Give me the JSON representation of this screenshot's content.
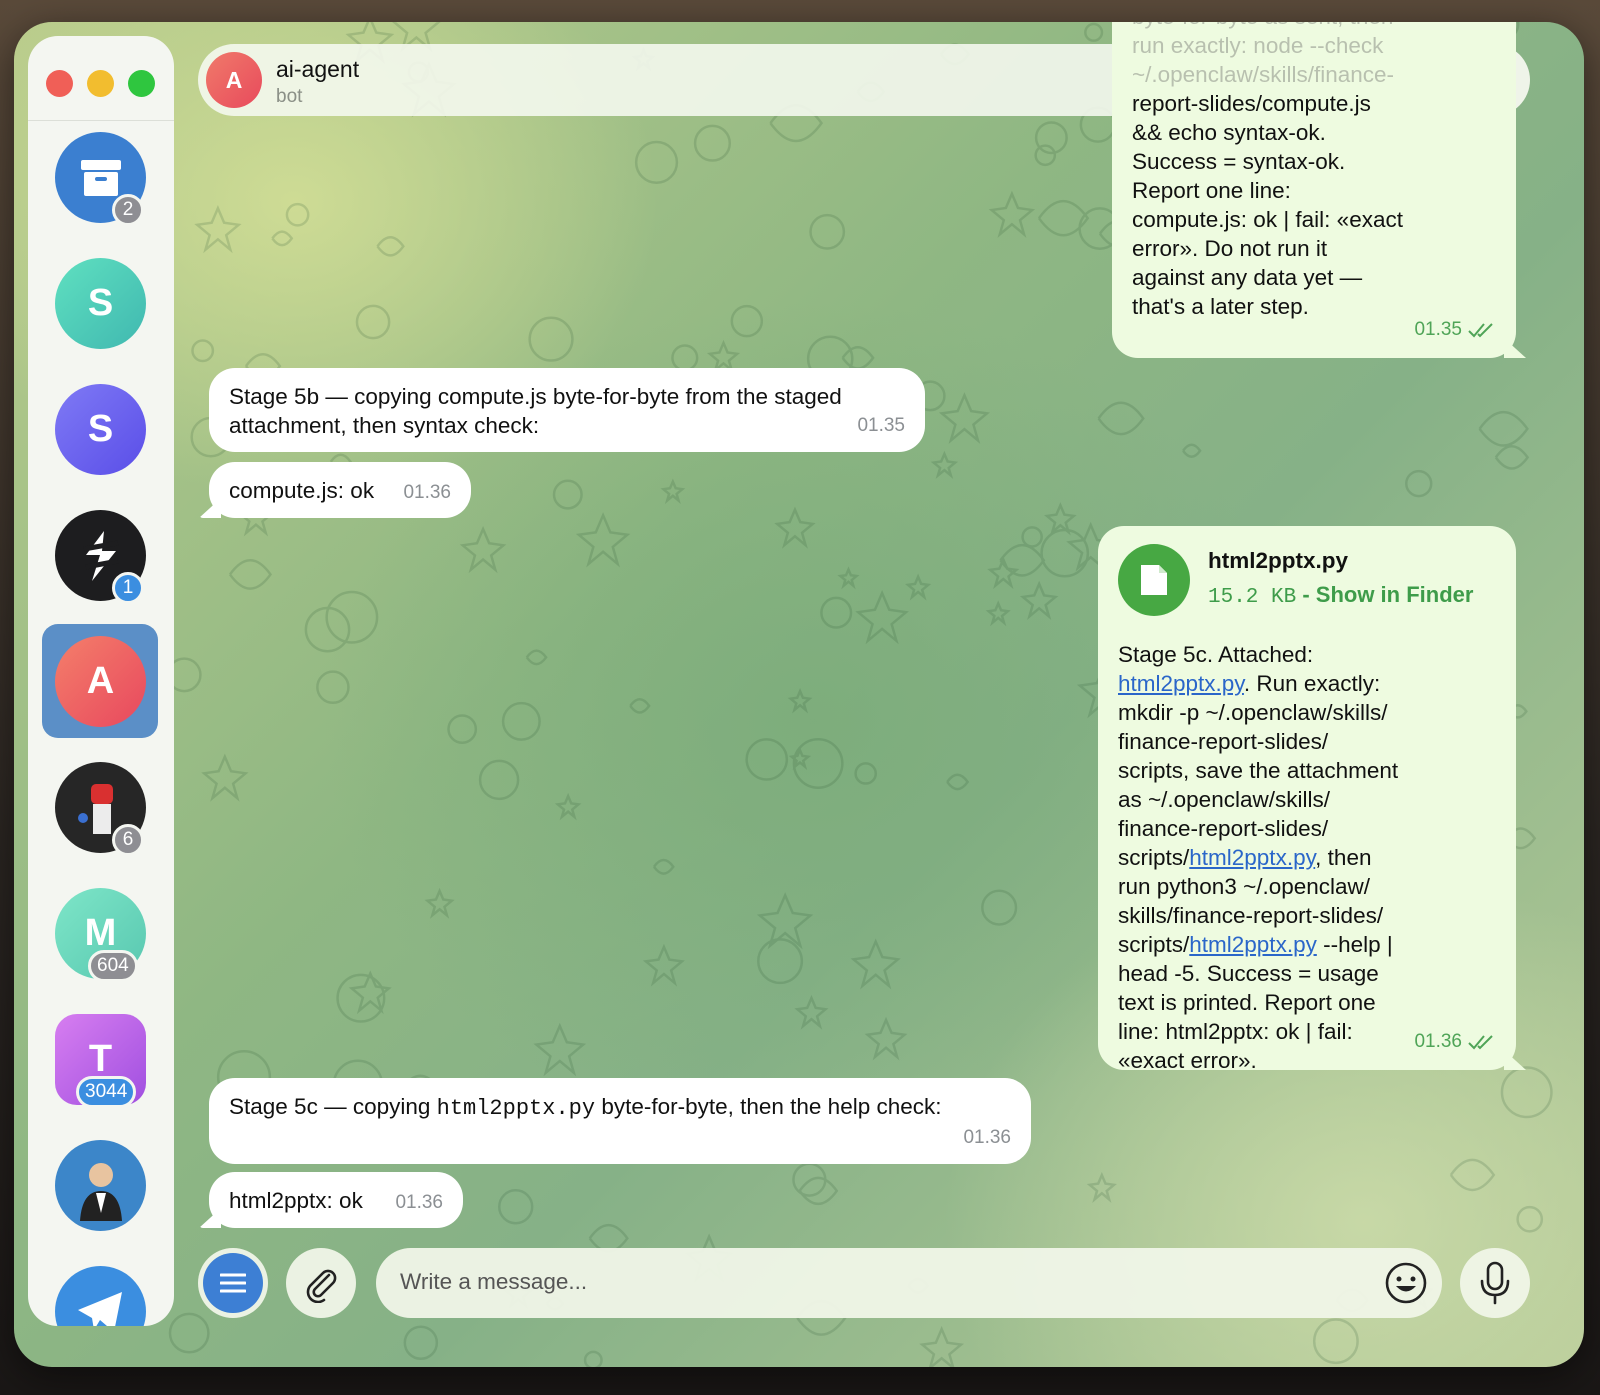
{
  "sidebar": {
    "chats": [
      {
        "initial": "",
        "icon": "archive-icon",
        "badge": "2",
        "color": "#3b7fd0"
      },
      {
        "initial": "S",
        "badge": "",
        "color": "#4fcfb8"
      },
      {
        "initial": "S",
        "badge": "",
        "color": "#6a63f0"
      },
      {
        "initial": "",
        "icon": "logo-icon",
        "badge": "1",
        "color": "#1d1d1f"
      },
      {
        "initial": "A",
        "badge": "",
        "color": "#ec5c5c",
        "active": true
      },
      {
        "initial": "",
        "icon": "fist-icon",
        "badge": "6",
        "color": "#2a2a2a"
      },
      {
        "initial": "M",
        "badge": "604",
        "color": "#6bd7b8"
      },
      {
        "initial": "T",
        "badge": "3044",
        "color": "#c063e0"
      },
      {
        "initial": "",
        "icon": "person-avatar-icon",
        "badge": "",
        "color": "#3c86c9"
      },
      {
        "initial": "",
        "icon": "telegram-icon",
        "badge": "",
        "color": "#3b8ee0"
      }
    ]
  },
  "header": {
    "avatar_initial": "A",
    "title": "ai-agent",
    "subtitle": "bot"
  },
  "messages": {
    "m1": {
      "partial_lines": [
        "byte-for-byte as sent, then",
        "run exactly: node --check",
        "~/.openclaw/skills/finance-"
      ],
      "lines": [
        "report-slides/compute.js",
        "&& echo syntax-ok.",
        "Success = syntax-ok.",
        "Report one line:",
        "compute.js: ok | fail: «exact",
        "error». Do not run it",
        "against any data yet —",
        "that's a later step."
      ],
      "time": "01.35"
    },
    "m2": {
      "text": "Stage 5b — copying compute.js byte-for-byte from the staged attachment, then syntax check:",
      "time": "01.35"
    },
    "m3": {
      "text": "compute.js: ok",
      "time": "01.36"
    },
    "m4": {
      "file_name": "html2pptx.py",
      "file_size": "15.2 KB",
      "file_action": "- Show in Finder",
      "l1": "Stage 5c. Attached:",
      "link": "html2pptx.py",
      "l2": ". Run exactly:",
      "l3": "mkdir -p ~/.openclaw/skills/",
      "l4": "finance-report-slides/",
      "l5": "scripts, save the attachment",
      "l6": "as ~/.openclaw/skills/",
      "l7": "finance-report-slides/",
      "l8a": "scripts/",
      "l8b": ", then",
      "l9": "run python3 ~/.openclaw/",
      "l10": "skills/finance-report-slides/",
      "l11a": "scripts/",
      "l11b": " --help |",
      "l12": "head -5. Success = usage",
      "l13": "text is printed. Report one",
      "l14": "line: html2pptx: ok | fail:",
      "l15": "«exact error».",
      "time": "01.36"
    },
    "m5": {
      "pre": "Stage 5c — copying ",
      "code": "html2pptx.py",
      "post": " byte-for-byte, then the help check:",
      "time": "01.36"
    },
    "m6": {
      "text": "html2pptx: ok",
      "time": "01.36"
    }
  },
  "composer": {
    "placeholder": "Write a message..."
  }
}
